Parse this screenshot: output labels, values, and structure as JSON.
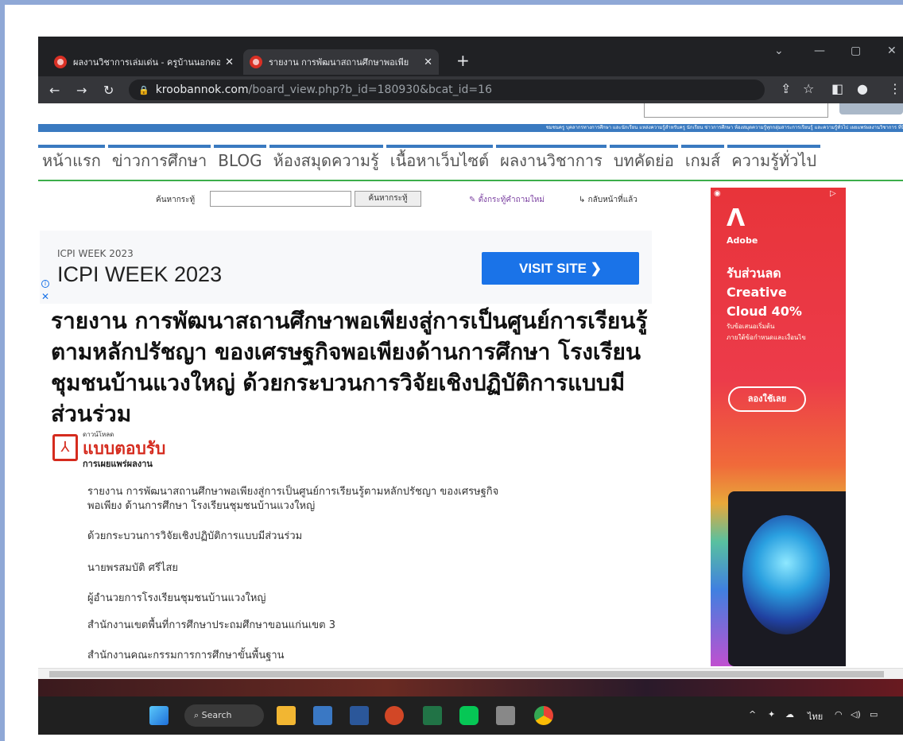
{
  "browser": {
    "tabs": [
      {
        "title": "ผลงานวิชาการเล่มเด่น - ครูบ้านนอกดอ",
        "active": false
      },
      {
        "title": "รายงาน การพัฒนาสถานศึกษาพอเพีย",
        "active": true
      }
    ],
    "new_tab_icon": "+",
    "url_host": "kroobannok.com",
    "url_path": "/board_view.php?b_id=180930&bcat_id=16"
  },
  "site": {
    "bluebar_text": "ชมชนครู บุคลากรทางการศึกษา และนักเรียน แหล่งความรู้สำหรับครู นักเรียน ข่าวการศึกษา ห้องสมุดความรู้ทุกกลุ่มสาระการเรียนรู้ และความรู้ทั่วไป เผยแพร่ผลงานวิชาการ ที่นี่",
    "menu": [
      "หน้าแรก",
      "ข่าวการศึกษา",
      "BLOG",
      "ห้องสมุดความรู้",
      "เนื้อหาเว็บไซต์",
      "ผลงานวิชาการ",
      "บทคัดย่อ",
      "เกมส์",
      "ความรู้ทั่วไป"
    ],
    "search_label": "ค้นหากระทู้",
    "search_button": "ค้นหากระทู้",
    "ask_link": "ตั้งกระทู้คำถามใหม่",
    "back_link": "กลับหน้าที่แล้ว"
  },
  "ad": {
    "small": "ICPI WEEK 2023",
    "big": "ICPI WEEK 2023",
    "cta": "VISIT SITE",
    "cta_icon": "chevron-right"
  },
  "article": {
    "title": "รายงาน การพัฒนาสถานศึกษาพอเพียงสู่การเป็นศูนย์การเรียนรู้ตามหลักปรัชญา ของเศรษฐกิจพอเพียงด้านการศึกษา โรงเรียนชุมชนบ้านแวงใหญ่ ด้วยกระบวนการวิจัยเชิงปฏิบัติการแบบมีส่วนร่วม",
    "pdf_small": "ดาวน์โหลด",
    "pdf_big": "แบบตอบรับ",
    "pdf_sub": "การเผยแพร่ผลงาน",
    "lines": [
      "รายงาน การพัฒนาสถานศึกษาพอเพียงสู่การเป็นศูนย์การเรียนรู้ตามหลักปรัชญา ของเศรษฐกิจ",
      "พอเพียง ด้านการศึกษา โรงเรียนชุมชนบ้านแวงใหญ่",
      "ด้วยกระบวนการวิจัยเชิงปฏิบัติการแบบมีส่วนร่วม",
      "นายพรสมบัติ ศรีไสย",
      "ผู้อำนวยการโรงเรียนชุมชนบ้านแวงใหญ่",
      "สำนักงานเขตพื้นที่การศึกษาประถมศึกษาขอนแก่นเขต 3",
      "สำนักงานคณะกรรมการการศึกษาขั้นพื้นฐาน"
    ]
  },
  "side_ad": {
    "brand": "Adobe",
    "headline": [
      "รับส่วนลด",
      "Creative",
      "Cloud 40%"
    ],
    "sub": [
      "รับข้อเสนอเริ่มต้น",
      "ภายใต้ข้อกำหนดและเงื่อนไข"
    ],
    "cta": "ลองใช้เลย"
  },
  "taskbar": {
    "search": "Search",
    "lang": "ไทย"
  }
}
